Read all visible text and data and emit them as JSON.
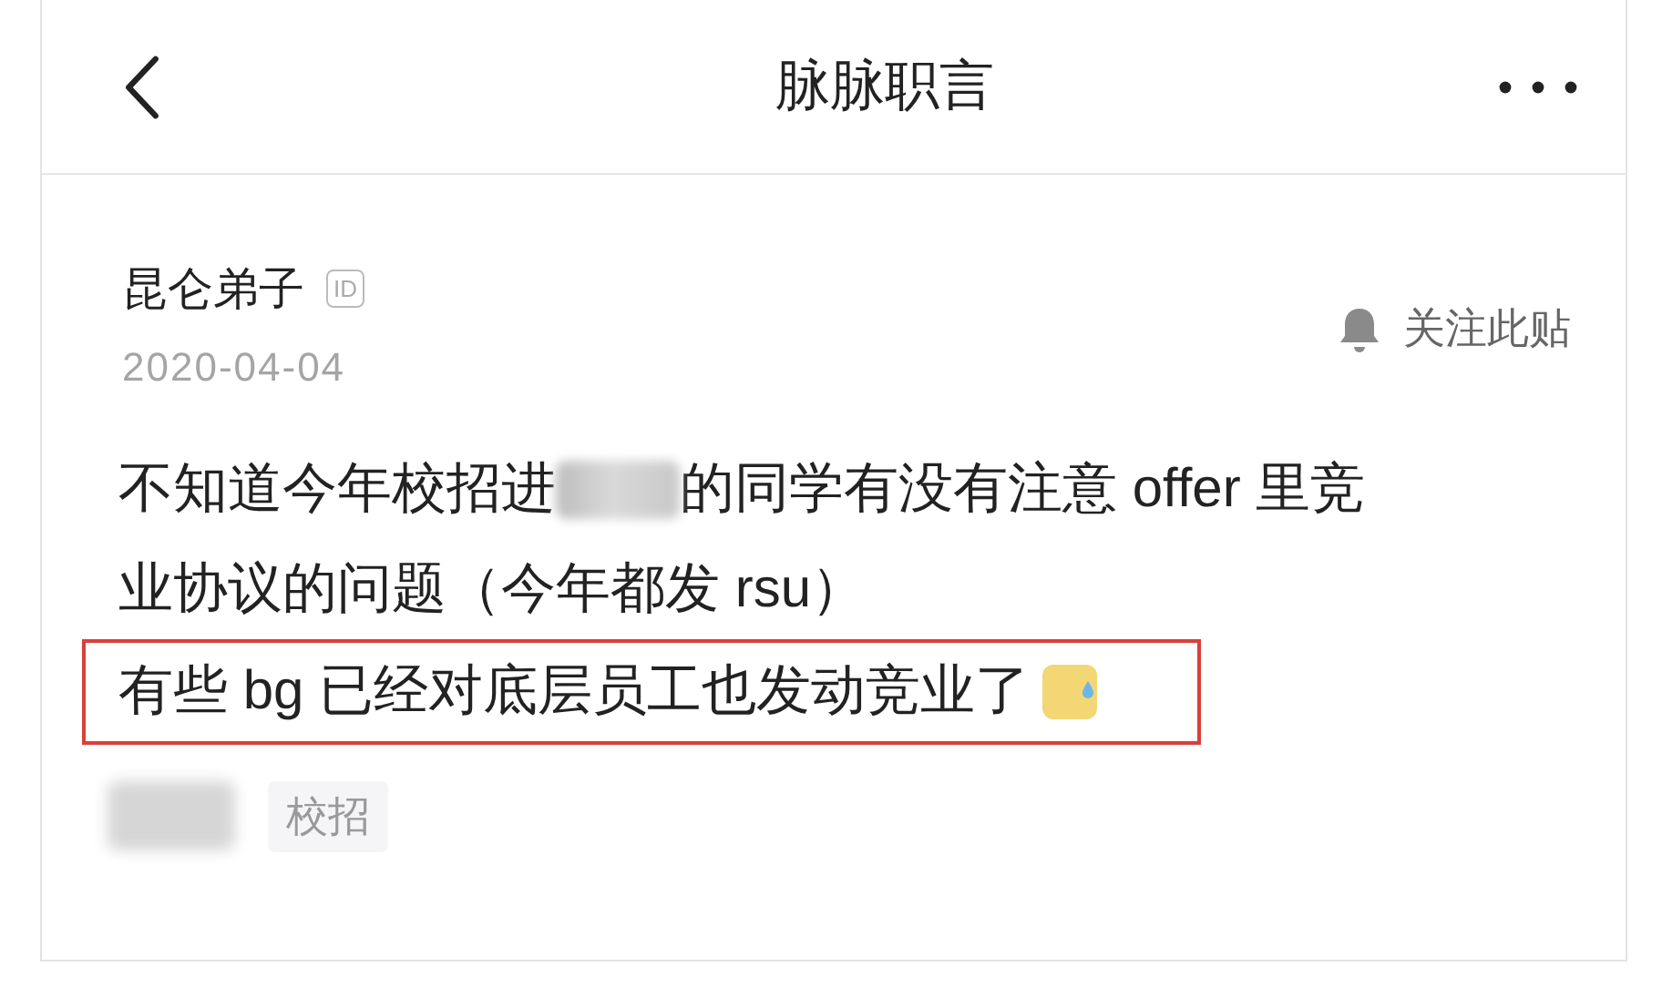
{
  "header": {
    "title": "脉脉职言"
  },
  "post": {
    "author": "昆仑弟子",
    "id_badge": "ID",
    "date": "2020-04-04",
    "follow": "关注此贴",
    "body_lines": [
      {
        "highlighted": false,
        "segments": [
          {
            "kind": "text",
            "text": "不知道今年校招进"
          },
          {
            "kind": "redacted"
          },
          {
            "kind": "text",
            "text": "的同学有没有注意 offer 里竞"
          }
        ]
      },
      {
        "highlighted": false,
        "segments": [
          {
            "kind": "text",
            "text": "业协议的问题（今年都发 rsu）"
          }
        ]
      },
      {
        "highlighted": true,
        "segments": [
          {
            "kind": "text",
            "text": "有些 bg 已经对底层员工也发动竞业了"
          },
          {
            "kind": "emoji"
          }
        ]
      }
    ],
    "tags": [
      {
        "kind": "redacted"
      },
      {
        "kind": "tag",
        "text": "校招"
      }
    ]
  }
}
